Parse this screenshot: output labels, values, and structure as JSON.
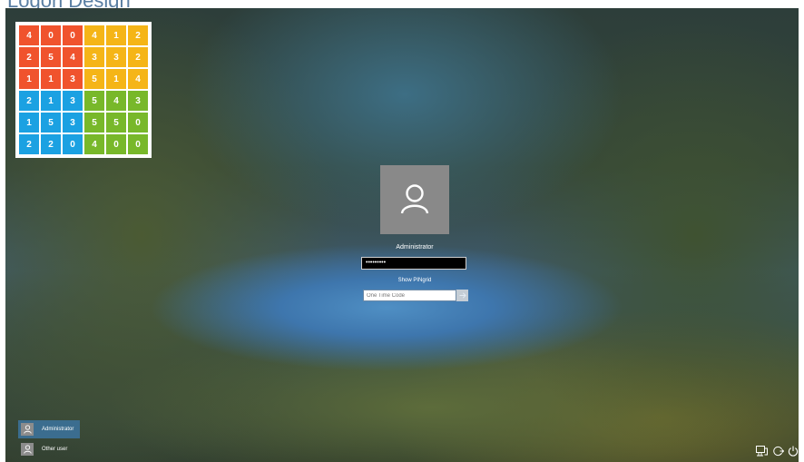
{
  "header": {
    "text": "Logon Design"
  },
  "grid": {
    "rows": [
      [
        "4",
        "0",
        "0",
        "4",
        "1",
        "2"
      ],
      [
        "2",
        "5",
        "4",
        "3",
        "3",
        "2"
      ],
      [
        "1",
        "1",
        "3",
        "5",
        "1",
        "4"
      ],
      [
        "2",
        "1",
        "3",
        "5",
        "4",
        "3"
      ],
      [
        "1",
        "5",
        "3",
        "5",
        "5",
        "0"
      ],
      [
        "2",
        "2",
        "0",
        "4",
        "0",
        "0"
      ]
    ],
    "colors": {
      "orange": "#f0532d",
      "yellow": "#f5b517",
      "blue": "#1ba1e2",
      "green": "#78b82a"
    }
  },
  "login": {
    "avatar_icon": "user-icon",
    "username": "Administrator",
    "password_mask": "•••••••••",
    "show_pin_label": "Show PINgrid",
    "otc_placeholder": "One Time Code",
    "submit_icon": "arrow-right-icon"
  },
  "users": [
    {
      "label": "Administrator",
      "icon": "user-icon",
      "selected": true
    },
    {
      "label": "Other user",
      "icon": "user-icon",
      "selected": false
    }
  ],
  "tray": {
    "network_icon": "network-icon",
    "accessibility_icon": "ease-of-access-icon",
    "power_icon": "power-icon"
  },
  "colors": {
    "avatar_bg": "#898989",
    "selected_user_bg": "#3b6d8f",
    "password_bg": "#000000"
  }
}
